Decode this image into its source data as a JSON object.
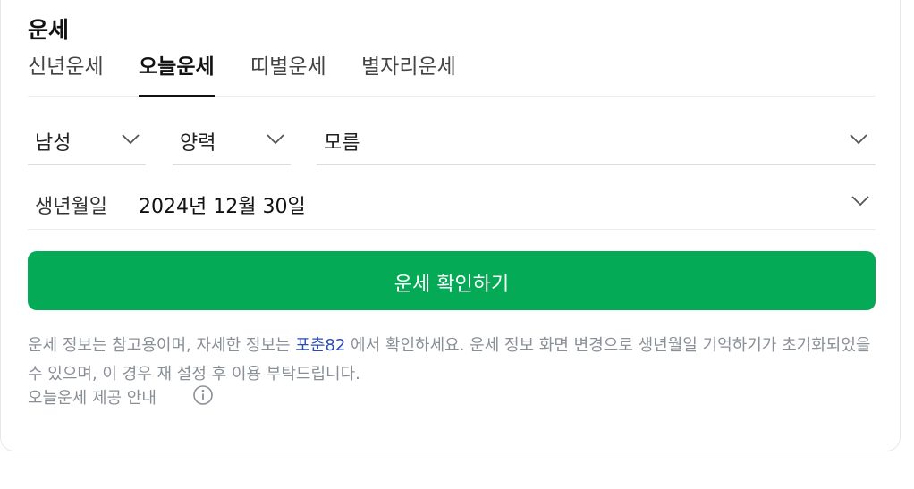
{
  "widget": {
    "title": "운세"
  },
  "tabs": [
    {
      "label": "신년운세",
      "active": false
    },
    {
      "label": "오늘운세",
      "active": true
    },
    {
      "label": "띠별운세",
      "active": false
    },
    {
      "label": "별자리운세",
      "active": false
    }
  ],
  "selects": {
    "gender": {
      "value": "남성"
    },
    "calendar": {
      "value": "양력"
    },
    "birth_time": {
      "value": "모름"
    }
  },
  "birthdate": {
    "label": "생년월일",
    "value": "2024년 12월 30일"
  },
  "cta": {
    "label": "운세 확인하기"
  },
  "notice": {
    "text_before": "운세 정보는 참고용이며, 자세한 정보는 ",
    "link": "포춘82",
    "text_after": " 에서 확인하세요. 운세 정보 화면 변경으로 생년월일 기억하기가 초기화되었을 수 있으며, 이 경우 재 설정 후 이용 부탁드립니다."
  },
  "provider_info": {
    "label": "오늘운세 제공 안내"
  },
  "colors": {
    "accent": "#05aa57",
    "link": "#2a4bb6",
    "muted": "#8a8f96"
  },
  "icons": {
    "chevron": "chevron-down-icon",
    "info": "info-icon"
  }
}
